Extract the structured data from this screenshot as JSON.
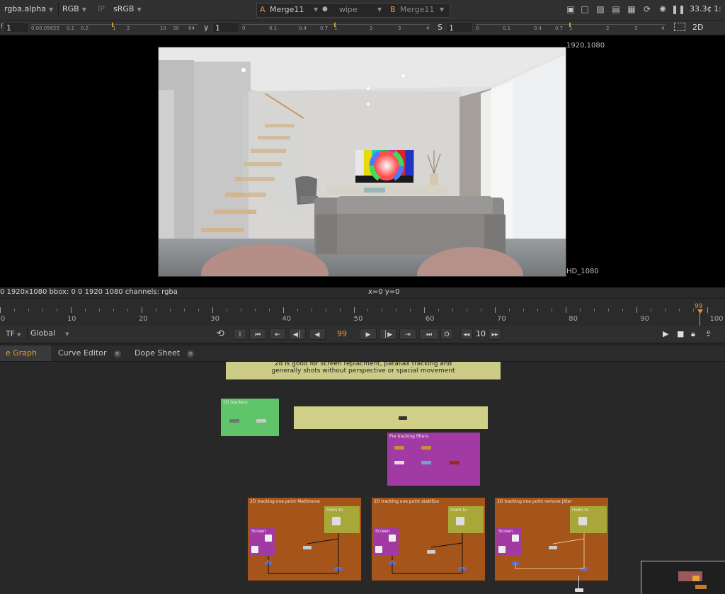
{
  "toolbar": {
    "channels": "rgba.alpha",
    "rgb": "RGB",
    "ip": "IP",
    "colorspace": "sRGB",
    "a_label": "A",
    "a_input": "Merge11",
    "wipe": "wipe",
    "b_label": "B",
    "b_input": "Merge11",
    "zoom": "33.3¢",
    "ratio": "1:",
    "icons": [
      "roi-icon",
      "mask-icon",
      "zebra-icon",
      "lut-icon",
      "refresh-icon",
      "update-icon",
      "pause-icon"
    ]
  },
  "gain": {
    "f_label": "f",
    "f_value": "1",
    "y_label": "y",
    "y_value": "1",
    "s_label": "S",
    "s_value": "1",
    "view_mode": "2D",
    "f_ticks": [
      "0.00.05625",
      "0.1",
      "0.2",
      "1",
      "2",
      "10",
      "30",
      "64"
    ],
    "y_ticks": [
      "0",
      "0.1",
      "0.4",
      "0.7",
      "1",
      "2",
      "3",
      "4"
    ],
    "s_ticks": [
      "0",
      "0.1",
      "0.4",
      "0.7",
      "1",
      "2",
      "3",
      "4"
    ]
  },
  "viewer": {
    "format_top": "1920,1080",
    "format_bottom": "HD_1080",
    "tv_colors": [
      "#e8e8e8",
      "#e8d90c",
      "#1fc7d0",
      "#2bb24c",
      "#c02fb8",
      "#d8262a",
      "#2434c4"
    ]
  },
  "info": {
    "left": "0 1920x1080  bbox: 0 0 1920 1080 channels: rgba",
    "coords": "x=0 y=0"
  },
  "timeline": {
    "current": "99",
    "ticks": [
      "0",
      "10",
      "20",
      "30",
      "40",
      "50",
      "60",
      "70",
      "80",
      "90",
      "100"
    ]
  },
  "playback": {
    "tf": "TF",
    "global": "Global",
    "frame": "99",
    "step": "10",
    "buttons": [
      "I",
      "⏮",
      "⇤",
      "◀│",
      "◀",
      "▶",
      "│▶",
      "⇥",
      "⏭",
      "O"
    ]
  },
  "tabs": [
    {
      "label": "e Graph"
    },
    {
      "label": "Curve Editor"
    },
    {
      "label": "Dope Sheet"
    }
  ],
  "graph": {
    "note_line1": "2d is good for screen replacment, parallax tracking and",
    "note_line2": "generally shots without perspective or spacial movement",
    "trackers": "2D trackers",
    "prefilters": "Pre tracking filters",
    "group1": "2D tracking one point Mathmove",
    "group2": "2D tracking one point stabilize",
    "group3": "2D tracking one point remove jitter",
    "room_tv": "room tv",
    "screen": "Screen"
  }
}
